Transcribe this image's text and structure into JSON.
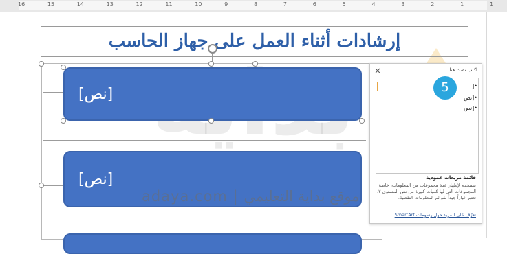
{
  "ruler": {
    "labels": [
      "16",
      "15",
      "14",
      "13",
      "12",
      "11",
      "10",
      "9",
      "8",
      "7",
      "6",
      "5",
      "4",
      "3",
      "2",
      "1",
      "1"
    ]
  },
  "document": {
    "title": "إرشادات أثناء العمل على جهاز الحاسب"
  },
  "smartart": {
    "shape_placeholder": "[نص]"
  },
  "text_pane": {
    "title": "اكتب نصك هنا",
    "close_glyph": "×",
    "rows": [
      "•[",
      "•[نص",
      "•[نص"
    ],
    "step_badge": "5",
    "desc_title": "قائمة مربعات عمودية",
    "desc_body": "تستخدم لإظهار عدة مجموعات من المعلومات، خاصة المجموعات التي لها كميات كبيرة من نص المستوى ٢. تعتبر خياراً جيداً لقوائم المعلومات النقطية.",
    "link": "تعرّف على المزيد حول رسومات SmartArt"
  },
  "watermark": {
    "big": "بداية",
    "line": "adaya.com | موقع بداية التعليمي"
  },
  "colors": {
    "accent_blue": "#4472c4",
    "title_blue": "#2e5fa8",
    "badge_blue": "#2aa6de"
  }
}
